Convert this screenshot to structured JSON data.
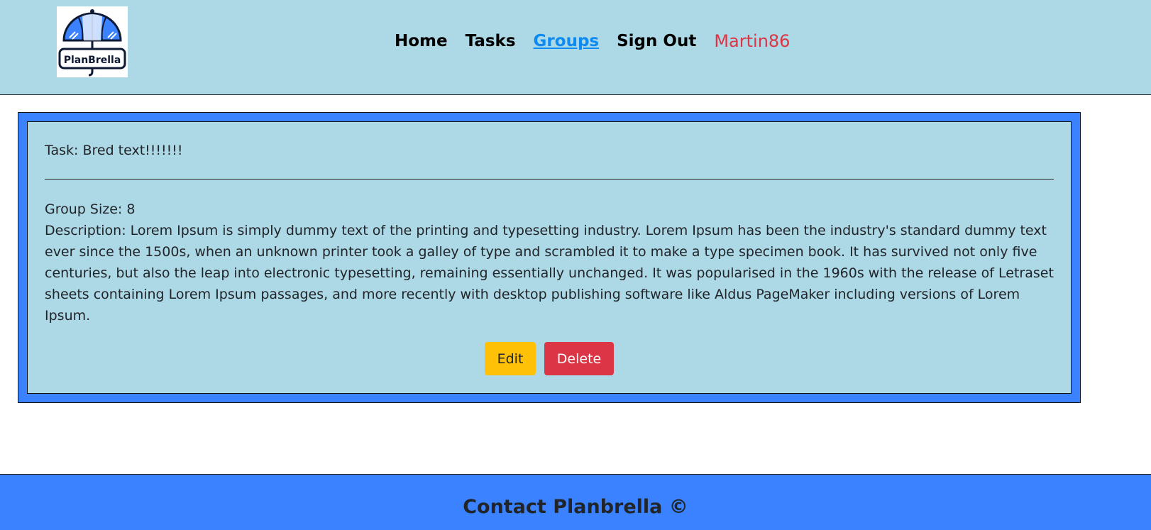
{
  "logo": {
    "text": "PlanBrella",
    "icon": "umbrella-icon"
  },
  "nav": {
    "home": "Home",
    "tasks": "Tasks",
    "groups": "Groups",
    "sign_out": "Sign Out",
    "username": "Martin86",
    "active_color": "#0d8bf2",
    "username_color": "#dc3545"
  },
  "card": {
    "task_title": "Task: Bred text!!!!!!!",
    "group_size": "Group Size: 8",
    "description": "Description: Lorem Ipsum is simply dummy text of the printing and typesetting industry. Lorem Ipsum has been the industry's standard dummy text ever since the 1500s, when an unknown printer took a galley of type and scrambled it to make a type specimen book. It has survived not only five centuries, but also the leap into electronic typesetting, remaining essentially unchanged. It was popularised in the 1960s with the release of Letraset sheets containing Lorem Ipsum passages, and more recently with desktop publishing software like Aldus PageMaker including versions of Lorem Ipsum.",
    "edit_label": "Edit",
    "delete_label": "Delete"
  },
  "footer": {
    "text": "Contact Planbrella ©"
  },
  "colors": {
    "header_bg": "#add8e6",
    "card_border_bg": "#3a82ff",
    "footer_bg": "#3a82ff",
    "edit_button": "#ffc107",
    "delete_button": "#dc3545"
  }
}
